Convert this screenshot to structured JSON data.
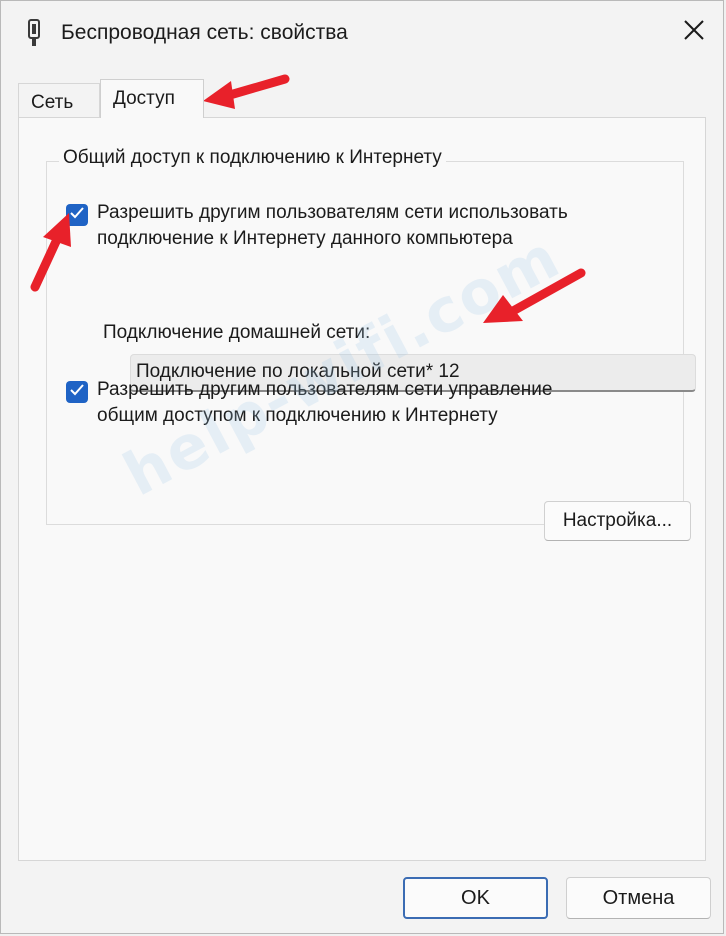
{
  "window": {
    "title": "Беспроводная сеть: свойства",
    "app_icon": "wireless-adapter-icon",
    "close_icon": "close-icon"
  },
  "tabs": [
    {
      "label": "Сеть",
      "active": false
    },
    {
      "label": "Доступ",
      "active": true
    }
  ],
  "sharing_group": {
    "legend": "Общий доступ к подключению к Интернету",
    "allow_use": {
      "checked": true,
      "line1": "Разрешить другим пользователям сети использовать",
      "line2": "подключение к Интернету данного компьютера"
    },
    "home_network_label": "Подключение домашней сети:",
    "home_network_value": "Подключение по локальной сети* 12",
    "allow_control": {
      "checked": true,
      "line1": "Разрешить другим пользователям сети управление",
      "line2": "общим доступом к подключению к Интернету"
    },
    "settings_button": "Настройка..."
  },
  "footer": {
    "ok": "OK",
    "cancel": "Отмена"
  },
  "watermark": "help-wifi.com",
  "colors": {
    "accent": "#1f63c5",
    "annotation_arrow": "#e8212a"
  }
}
